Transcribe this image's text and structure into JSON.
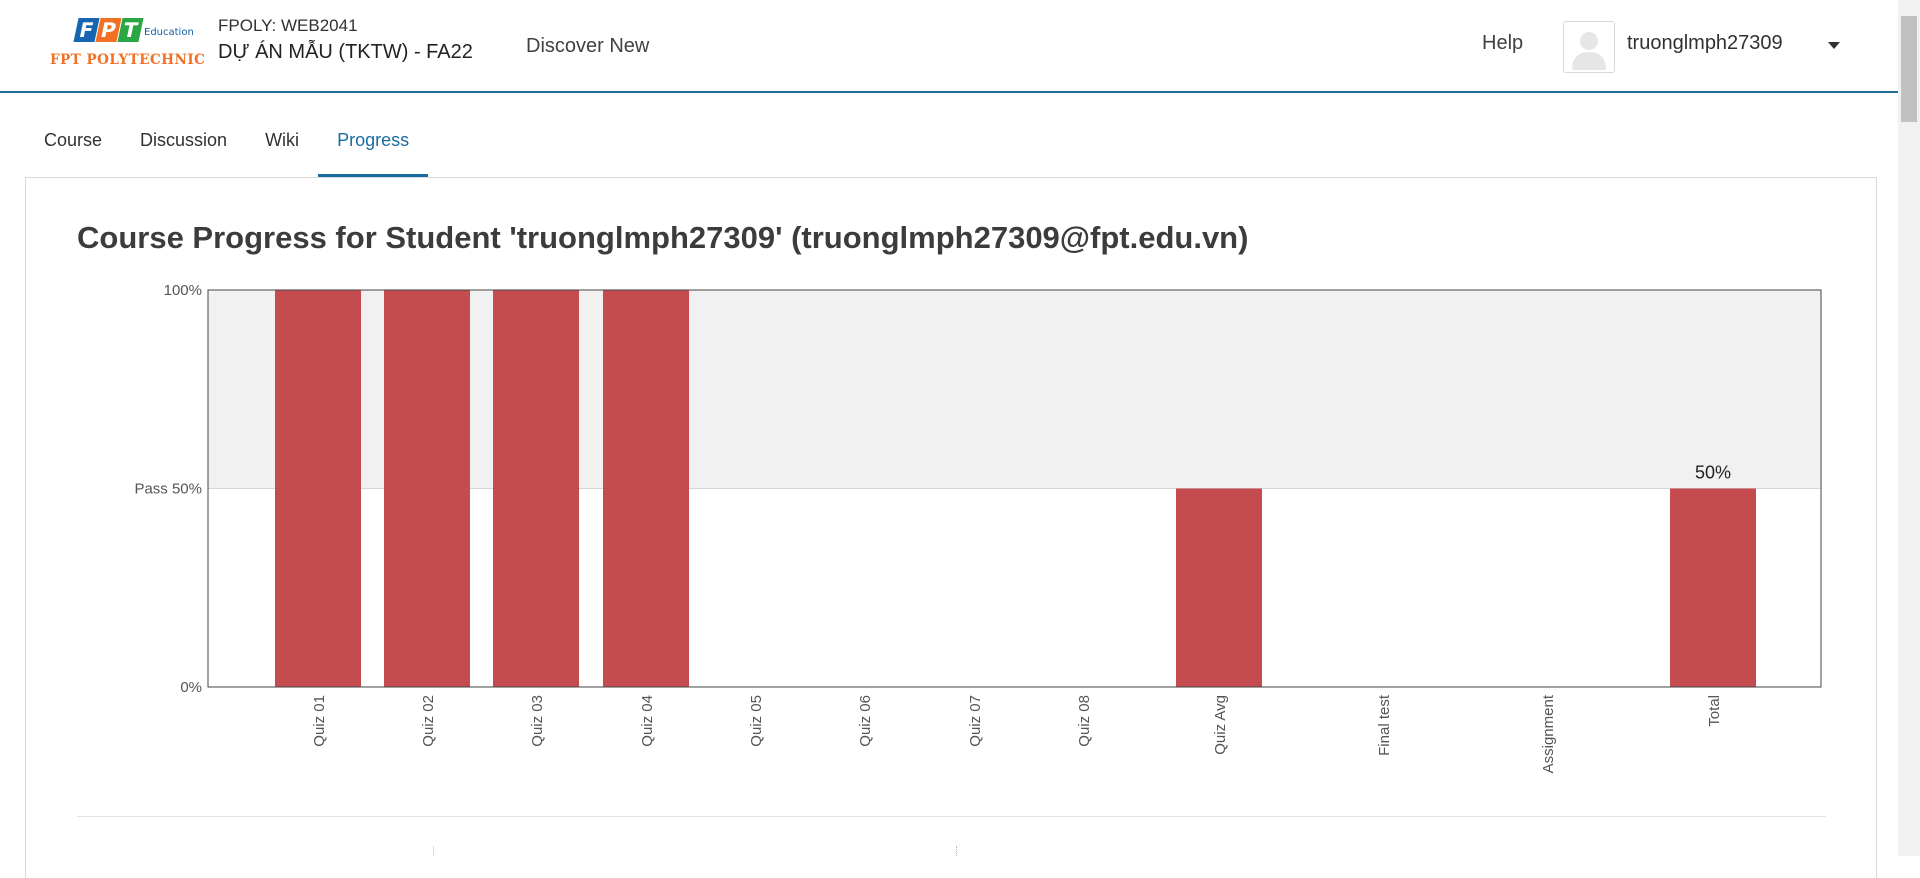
{
  "header": {
    "logo": {
      "letters": [
        "F",
        "P",
        "T"
      ],
      "letter_colors": [
        "#1665b3",
        "#f27024",
        "#2aa744"
      ],
      "edu_text": "Education",
      "brand_text": "FPT POLYTECHNIC"
    },
    "course_code": "FPOLY: WEB2041",
    "course_name": "DỰ ÁN MẪU (TKTW) - FA22",
    "discover": "Discover New",
    "help": "Help",
    "username": "truonglmph27309",
    "avatar_icon": "user-silhouette-icon",
    "dropdown_icon": "caret-down-icon"
  },
  "tabs": [
    {
      "label": "Course",
      "active": false
    },
    {
      "label": "Discussion",
      "active": false
    },
    {
      "label": "Wiki",
      "active": false
    },
    {
      "label": "Progress",
      "active": true
    }
  ],
  "page": {
    "title": "Course Progress for Student 'truonglmph27309' (truonglmph27309@fpt.edu.vn)"
  },
  "colors": {
    "accent": "#1a6ca0",
    "bar": "#c44b4e",
    "pass_band": "#f1f1f1"
  },
  "chart_data": {
    "type": "bar",
    "categories": [
      "Quiz 01",
      "Quiz 02",
      "Quiz 03",
      "Quiz 04",
      "Quiz 05",
      "Quiz 06",
      "Quiz 07",
      "Quiz 08",
      "Quiz Avg",
      "Final test",
      "Assignment",
      "Total"
    ],
    "values": [
      100,
      100,
      100,
      100,
      0,
      0,
      0,
      0,
      50,
      0,
      0,
      50
    ],
    "ylim": [
      0,
      100
    ],
    "y_ticks": [
      {
        "value": 100,
        "label": "100%"
      },
      {
        "value": 50,
        "label": "Pass 50%"
      },
      {
        "value": 0,
        "label": "0%"
      }
    ],
    "data_labels": [
      {
        "category": "Total",
        "label": "50%"
      }
    ],
    "pass_threshold": 50
  }
}
